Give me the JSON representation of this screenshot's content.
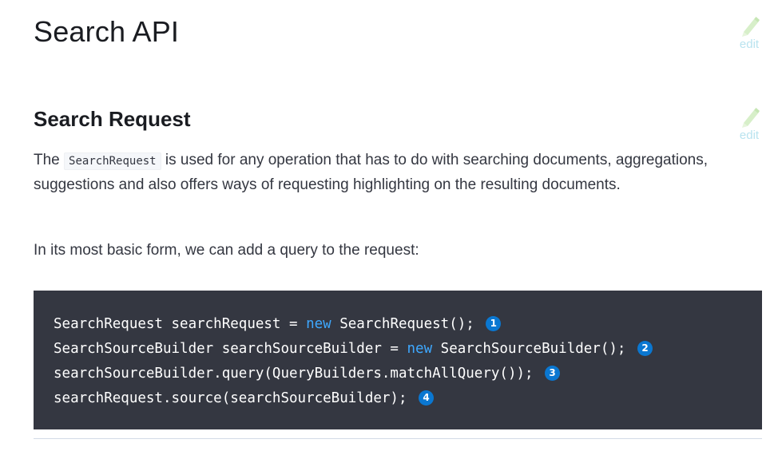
{
  "page": {
    "title": "Search API",
    "edit_label": "edit"
  },
  "section": {
    "title": "Search Request",
    "edit_label": "edit",
    "paragraph1": {
      "before": "The",
      "code": "SearchRequest",
      "after": "is used for any operation that has to do with searching documents, aggregations, suggestions and also offers ways of requesting highlighting on the resulting documents."
    },
    "paragraph2": "In its most basic form, we can add a query to the request:"
  },
  "code_block": {
    "lines": [
      {
        "before": "SearchRequest searchRequest = ",
        "keyword": "new",
        "after": " SearchRequest();",
        "callout": "1"
      },
      {
        "before": "SearchSourceBuilder searchSourceBuilder = ",
        "keyword": "new",
        "after": " SearchSourceBuilder();",
        "callout": "2"
      },
      {
        "before": "searchSourceBuilder.query(QueryBuilders.matchAllQuery());",
        "keyword": "",
        "after": "",
        "callout": "3"
      },
      {
        "before": "searchRequest.source(searchSourceBuilder);",
        "keyword": "",
        "after": "",
        "callout": "4"
      }
    ]
  },
  "colors": {
    "code_background": "#343741",
    "keyword": "#3ea8ff",
    "callout_background": "#0a77d1",
    "edit_link": "#b9e3ef"
  },
  "icons": {
    "edit": "pencil-icon"
  }
}
